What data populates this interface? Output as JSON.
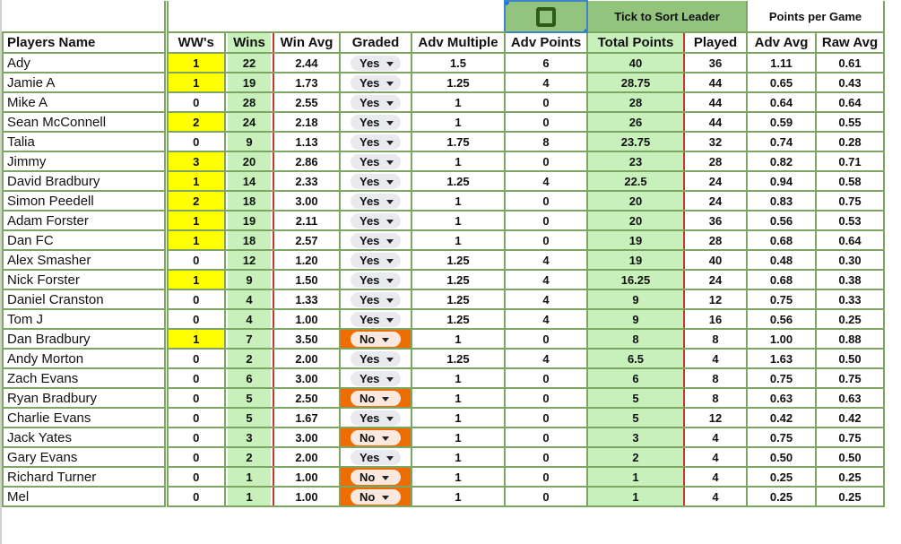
{
  "controls": {
    "sort_checkbox_checked": false,
    "sort_label": "Tick to Sort Leader",
    "points_per_game_label": "Points per Game"
  },
  "columns": [
    "Players Name",
    "WW's",
    "Wins",
    "Win Avg",
    "Graded",
    "Adv Multiple",
    "Adv Points",
    "Total Points",
    "Played",
    "Adv Avg",
    "Raw Avg"
  ],
  "colors": {
    "highlight_ww": "#ffff00",
    "wins_fill": "#c8f0bb",
    "graded_no": "#ef6c00",
    "header_green": "#93c47d",
    "sort_text": "#cc0000"
  },
  "rows": [
    {
      "name": "Ady",
      "ww": "1",
      "wins": "22",
      "win_avg": "2.44",
      "graded": "Yes",
      "adv_multiple": "1.5",
      "adv_points": "6",
      "total": "40",
      "played": "36",
      "adv_avg": "1.11",
      "raw_avg": "0.61"
    },
    {
      "name": "Jamie A",
      "ww": "1",
      "wins": "19",
      "win_avg": "1.73",
      "graded": "Yes",
      "adv_multiple": "1.25",
      "adv_points": "4",
      "total": "28.75",
      "played": "44",
      "adv_avg": "0.65",
      "raw_avg": "0.43"
    },
    {
      "name": "Mike A",
      "ww": "0",
      "wins": "28",
      "win_avg": "2.55",
      "graded": "Yes",
      "adv_multiple": "1",
      "adv_points": "0",
      "total": "28",
      "played": "44",
      "adv_avg": "0.64",
      "raw_avg": "0.64"
    },
    {
      "name": "Sean McConnell",
      "ww": "2",
      "wins": "24",
      "win_avg": "2.18",
      "graded": "Yes",
      "adv_multiple": "1",
      "adv_points": "0",
      "total": "26",
      "played": "44",
      "adv_avg": "0.59",
      "raw_avg": "0.55"
    },
    {
      "name": "Talia",
      "ww": "0",
      "wins": "9",
      "win_avg": "1.13",
      "graded": "Yes",
      "adv_multiple": "1.75",
      "adv_points": "8",
      "total": "23.75",
      "played": "32",
      "adv_avg": "0.74",
      "raw_avg": "0.28"
    },
    {
      "name": "Jimmy",
      "ww": "3",
      "wins": "20",
      "win_avg": "2.86",
      "graded": "Yes",
      "adv_multiple": "1",
      "adv_points": "0",
      "total": "23",
      "played": "28",
      "adv_avg": "0.82",
      "raw_avg": "0.71"
    },
    {
      "name": "David Bradbury",
      "ww": "1",
      "wins": "14",
      "win_avg": "2.33",
      "graded": "Yes",
      "adv_multiple": "1.25",
      "adv_points": "4",
      "total": "22.5",
      "played": "24",
      "adv_avg": "0.94",
      "raw_avg": "0.58"
    },
    {
      "name": "Simon Peedell",
      "ww": "2",
      "wins": "18",
      "win_avg": "3.00",
      "graded": "Yes",
      "adv_multiple": "1",
      "adv_points": "0",
      "total": "20",
      "played": "24",
      "adv_avg": "0.83",
      "raw_avg": "0.75"
    },
    {
      "name": "Adam Forster",
      "ww": "1",
      "wins": "19",
      "win_avg": "2.11",
      "graded": "Yes",
      "adv_multiple": "1",
      "adv_points": "0",
      "total": "20",
      "played": "36",
      "adv_avg": "0.56",
      "raw_avg": "0.53"
    },
    {
      "name": "Dan FC",
      "ww": "1",
      "wins": "18",
      "win_avg": "2.57",
      "graded": "Yes",
      "adv_multiple": "1",
      "adv_points": "0",
      "total": "19",
      "played": "28",
      "adv_avg": "0.68",
      "raw_avg": "0.64"
    },
    {
      "name": "Alex Smasher",
      "ww": "0",
      "wins": "12",
      "win_avg": "1.20",
      "graded": "Yes",
      "adv_multiple": "1.25",
      "adv_points": "4",
      "total": "19",
      "played": "40",
      "adv_avg": "0.48",
      "raw_avg": "0.30"
    },
    {
      "name": "Nick Forster",
      "ww": "1",
      "wins": "9",
      "win_avg": "1.50",
      "graded": "Yes",
      "adv_multiple": "1.25",
      "adv_points": "4",
      "total": "16.25",
      "played": "24",
      "adv_avg": "0.68",
      "raw_avg": "0.38"
    },
    {
      "name": "Daniel Cranston",
      "ww": "0",
      "wins": "4",
      "win_avg": "1.33",
      "graded": "Yes",
      "adv_multiple": "1.25",
      "adv_points": "4",
      "total": "9",
      "played": "12",
      "adv_avg": "0.75",
      "raw_avg": "0.33"
    },
    {
      "name": "Tom J",
      "ww": "0",
      "wins": "4",
      "win_avg": "1.00",
      "graded": "Yes",
      "adv_multiple": "1.25",
      "adv_points": "4",
      "total": "9",
      "played": "16",
      "adv_avg": "0.56",
      "raw_avg": "0.25"
    },
    {
      "name": "Dan Bradbury",
      "ww": "1",
      "wins": "7",
      "win_avg": "3.50",
      "graded": "No",
      "adv_multiple": "1",
      "adv_points": "0",
      "total": "8",
      "played": "8",
      "adv_avg": "1.00",
      "raw_avg": "0.88"
    },
    {
      "name": "Andy Morton",
      "ww": "0",
      "wins": "2",
      "win_avg": "2.00",
      "graded": "Yes",
      "adv_multiple": "1.25",
      "adv_points": "4",
      "total": "6.5",
      "played": "4",
      "adv_avg": "1.63",
      "raw_avg": "0.50"
    },
    {
      "name": "Zach Evans",
      "ww": "0",
      "wins": "6",
      "win_avg": "3.00",
      "graded": "Yes",
      "adv_multiple": "1",
      "adv_points": "0",
      "total": "6",
      "played": "8",
      "adv_avg": "0.75",
      "raw_avg": "0.75"
    },
    {
      "name": "Ryan Bradbury",
      "ww": "0",
      "wins": "5",
      "win_avg": "2.50",
      "graded": "No",
      "adv_multiple": "1",
      "adv_points": "0",
      "total": "5",
      "played": "8",
      "adv_avg": "0.63",
      "raw_avg": "0.63"
    },
    {
      "name": "Charlie Evans",
      "ww": "0",
      "wins": "5",
      "win_avg": "1.67",
      "graded": "Yes",
      "adv_multiple": "1",
      "adv_points": "0",
      "total": "5",
      "played": "12",
      "adv_avg": "0.42",
      "raw_avg": "0.42"
    },
    {
      "name": "Jack Yates",
      "ww": "0",
      "wins": "3",
      "win_avg": "3.00",
      "graded": "No",
      "adv_multiple": "1",
      "adv_points": "0",
      "total": "3",
      "played": "4",
      "adv_avg": "0.75",
      "raw_avg": "0.75"
    },
    {
      "name": "Gary Evans",
      "ww": "0",
      "wins": "2",
      "win_avg": "2.00",
      "graded": "Yes",
      "adv_multiple": "1",
      "adv_points": "0",
      "total": "2",
      "played": "4",
      "adv_avg": "0.50",
      "raw_avg": "0.50"
    },
    {
      "name": "Richard Turner",
      "ww": "0",
      "wins": "1",
      "win_avg": "1.00",
      "graded": "No",
      "adv_multiple": "1",
      "adv_points": "0",
      "total": "1",
      "played": "4",
      "adv_avg": "0.25",
      "raw_avg": "0.25"
    },
    {
      "name": "Mel",
      "ww": "0",
      "wins": "1",
      "win_avg": "1.00",
      "graded": "No",
      "adv_multiple": "1",
      "adv_points": "0",
      "total": "1",
      "played": "4",
      "adv_avg": "0.25",
      "raw_avg": "0.25"
    }
  ]
}
